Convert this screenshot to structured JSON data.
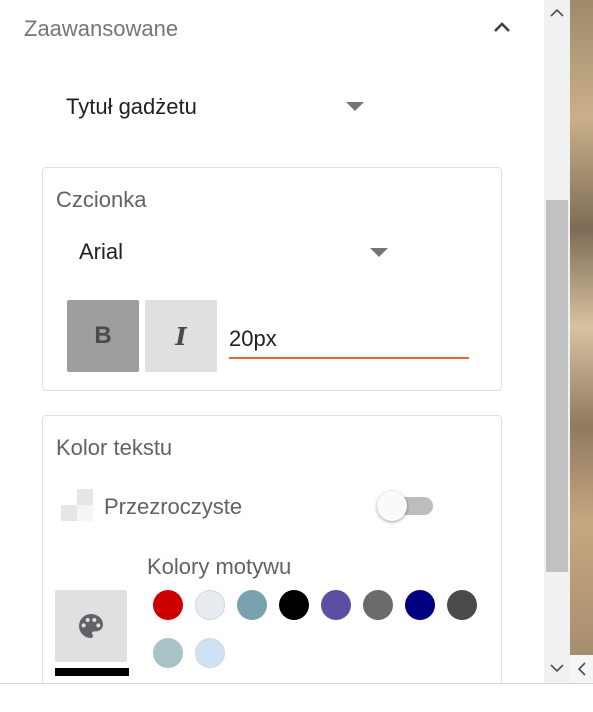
{
  "section": {
    "title": "Zaawansowane"
  },
  "gadget_title_dropdown": {
    "label": "Tytuł gadżetu"
  },
  "font_card": {
    "title": "Czcionka",
    "font_family": "Arial",
    "bold_label": "B",
    "italic_label": "I",
    "size_value": "20px",
    "bold_active": true
  },
  "text_color_card": {
    "title": "Kolor tekstu",
    "transparent_label": "Przezroczyste",
    "transparent_enabled": false,
    "theme_colors_label": "Kolory motywu",
    "current_color": "#000000",
    "swatches": [
      "#cc0000",
      "#e6ecef",
      "#78a3ae",
      "#000000",
      "#5a4fa0",
      "#6b6b6b",
      "#000080",
      "#4a4a4a",
      "#a7c3c8",
      "#cfe2f3"
    ]
  },
  "colors": {
    "accent": "#e8662f"
  },
  "icons": {
    "collapse": "chevron-up-icon",
    "dropdown": "triangle-down-icon",
    "transparent": "checkerboard-icon",
    "palette": "palette-icon",
    "scroll_up": "chevron-up-icon",
    "scroll_down": "chevron-down-icon",
    "scroll_left": "chevron-left-icon"
  }
}
